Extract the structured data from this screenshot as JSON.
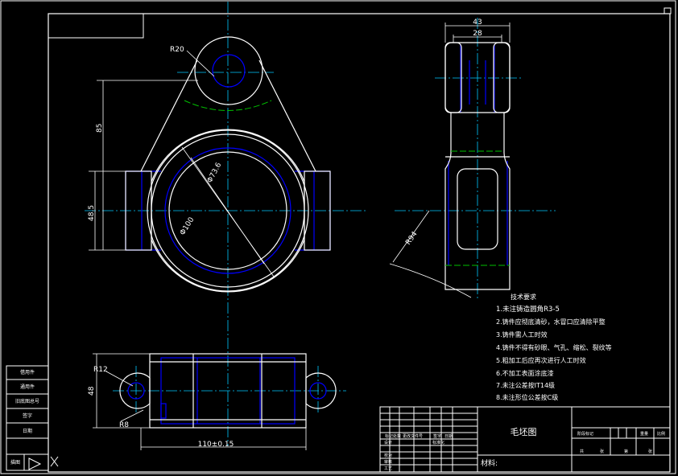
{
  "colors": {
    "background": "#000000",
    "outline": "#ffffff",
    "center_line": "#00c8ff",
    "hidden_line": "#0000ff",
    "green_line": "#00c000"
  },
  "dimensions": {
    "r20": "R20",
    "d85": "85",
    "d48_5": "48.5",
    "phi73_6": "Φ73.6",
    "phi100": "Φ100",
    "w43": "43",
    "w28": "28",
    "r94": "R94",
    "r12": "R12",
    "h48": "48",
    "r8": "R8",
    "len110": "110±0.15"
  },
  "tech_requirements": {
    "heading": "技术要求",
    "items": [
      "1.未注铸造圆角R3-5",
      "2.铸件应彻底清砂，水冒口应清除平整",
      "3.铸件需人工时效",
      "4.铸件不得有砂眼、气孔、缩松、裂纹等",
      "5.粗加工后应再次进行人工时效",
      "6.不加工表面涂底漆",
      "7.未注公差按IT14级",
      "8.未注形位公差按C级"
    ]
  },
  "title_block": {
    "drawing_name": "毛坯图",
    "material_label": "材料:",
    "left_header": [
      "标记",
      "处数",
      "更改文件号",
      "签字",
      "日期"
    ],
    "left_rows": [
      "设计",
      "校对",
      "审核",
      "工艺"
    ],
    "std_label": "标准化",
    "batch_label": "阶段标记",
    "right_header": [
      "重量",
      "比例"
    ],
    "sheet_row": [
      "共",
      "张",
      "第",
      "张"
    ]
  },
  "side_strip": {
    "rows": [
      "借用件",
      "通用件",
      "旧底图总号",
      "签字",
      "日期"
    ],
    "bottom": "描图"
  }
}
